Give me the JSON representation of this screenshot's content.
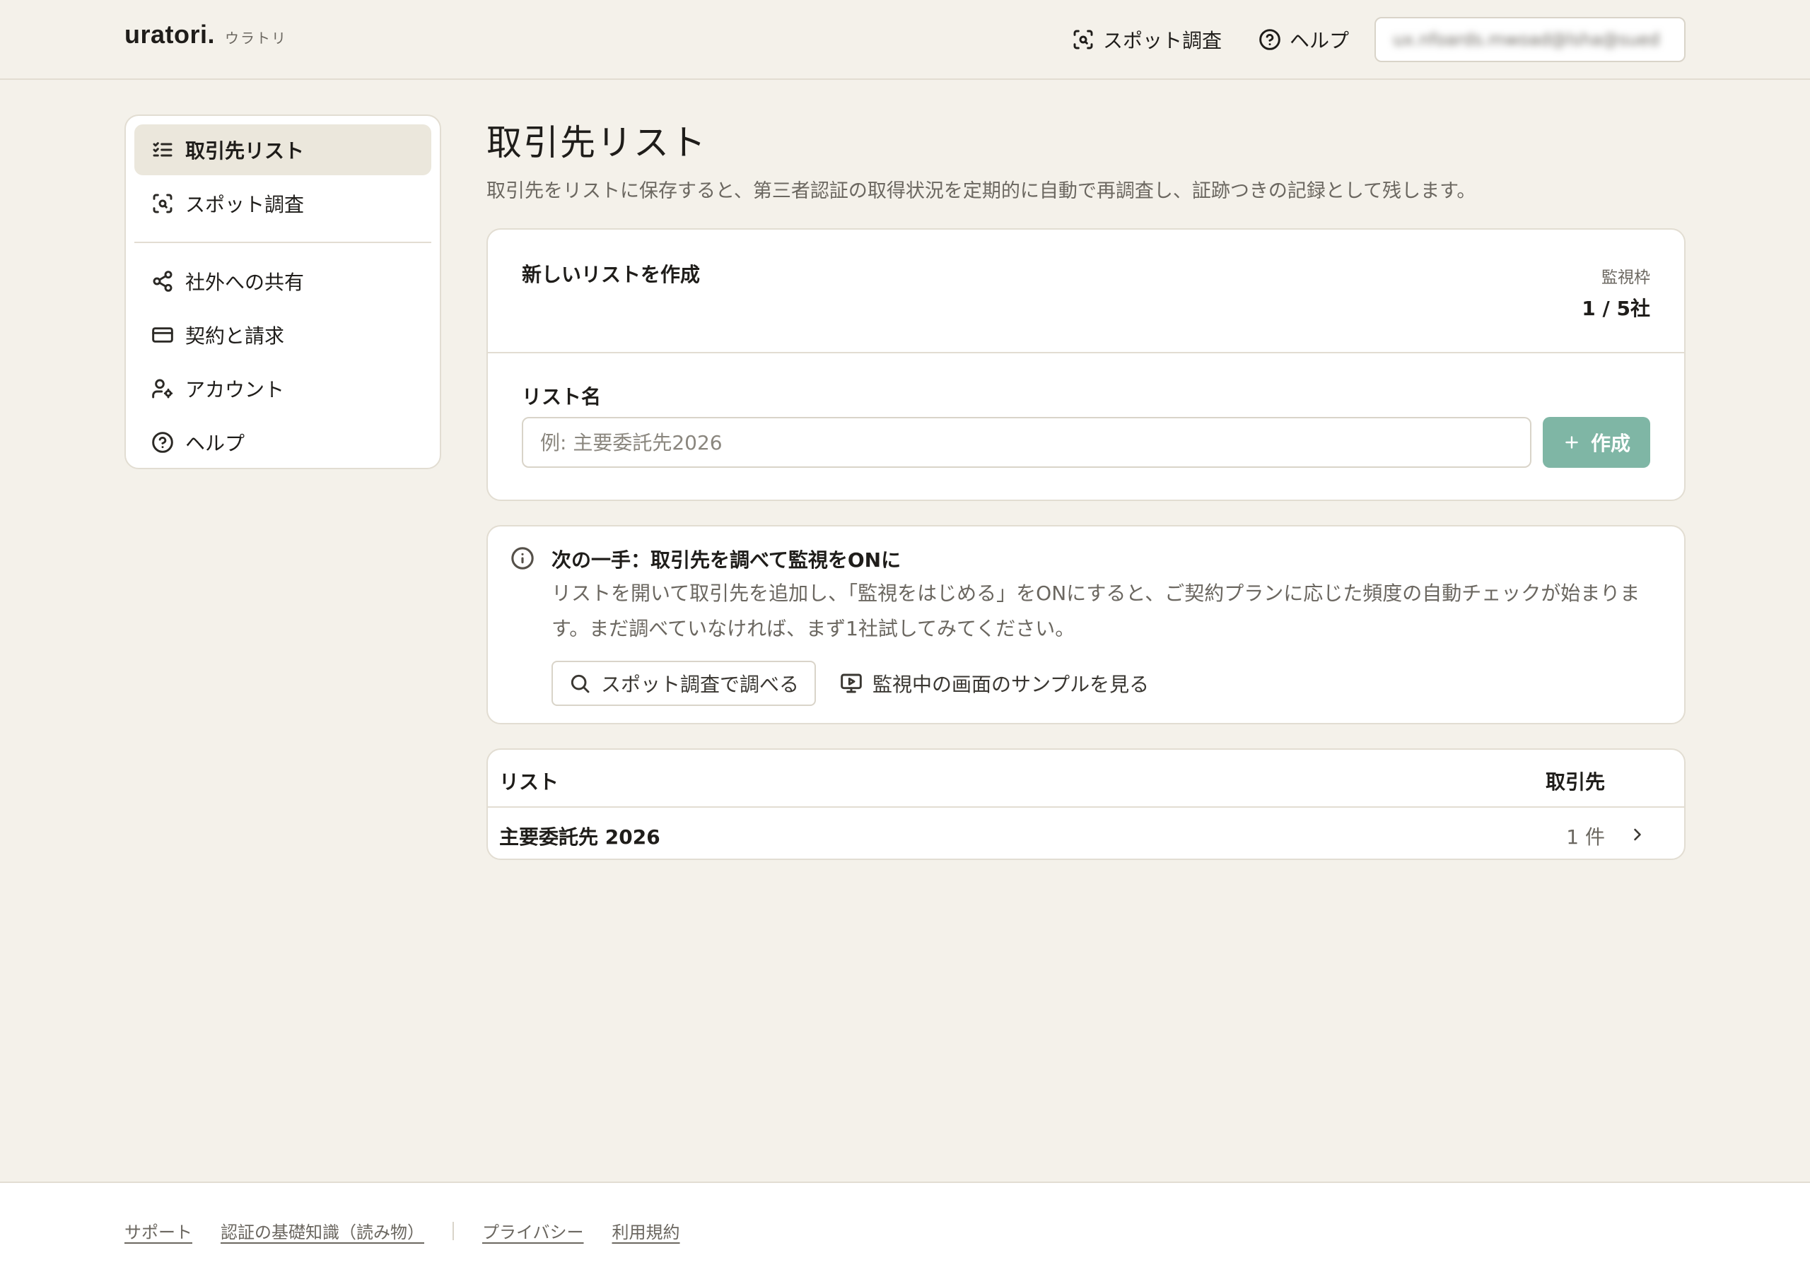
{
  "brand": {
    "name": "uratori.",
    "kana": "ウラトリ"
  },
  "header": {
    "spot_label": "スポット調査",
    "help_label": "ヘルプ",
    "account_email": "ux.nfoards.mwoad@lsha@sued"
  },
  "sidebar": {
    "items": [
      {
        "label": "取引先リスト",
        "icon": "checklist-icon",
        "active": true
      },
      {
        "label": "スポット調査",
        "icon": "scan-search-icon"
      },
      {
        "label": "社外への共有",
        "icon": "share-icon"
      },
      {
        "label": "契約と請求",
        "icon": "credit-card-icon"
      },
      {
        "label": "アカウント",
        "icon": "user-settings-icon"
      },
      {
        "label": "ヘルプ",
        "icon": "help-circle-icon"
      }
    ]
  },
  "main": {
    "title": "取引先リスト",
    "description": "取引先をリストに保存すると、第三者認証の取得状況を定期的に自動で再調査し、証跡つきの記録として残します。",
    "create": {
      "title": "新しいリストを作成",
      "quota_label": "監視枠",
      "quota_value": "1 / 5社",
      "field_label": "リスト名",
      "placeholder": "例: 主要委託先2026",
      "value": "",
      "button_label": "作成"
    },
    "next_step": {
      "title": "次の一手：取引先を調べて監視をONに",
      "body": "リストを開いて取引先を追加し、「監視をはじめる」をONにすると、ご契約プランに応じた頻度の自動チェックが始まります。まだ調べていなければ、まず1社試してみてください。",
      "spot_button": "スポット調査で調べる",
      "sample_button": "監視中の画面のサンプルを見る"
    },
    "table": {
      "columns": [
        "リスト",
        "取引先"
      ],
      "rows": [
        {
          "name": "主要委託先 2026",
          "count": "1 件"
        }
      ]
    }
  },
  "footer": {
    "links": [
      "サポート",
      "認証の基礎知識（読み物）",
      "プライバシー",
      "利用規約"
    ]
  },
  "colors": {
    "background": "#f4f1ea",
    "accent": "#7fb6a5",
    "active_nav": "#ebe7dc",
    "border": "#e2ddd2"
  }
}
